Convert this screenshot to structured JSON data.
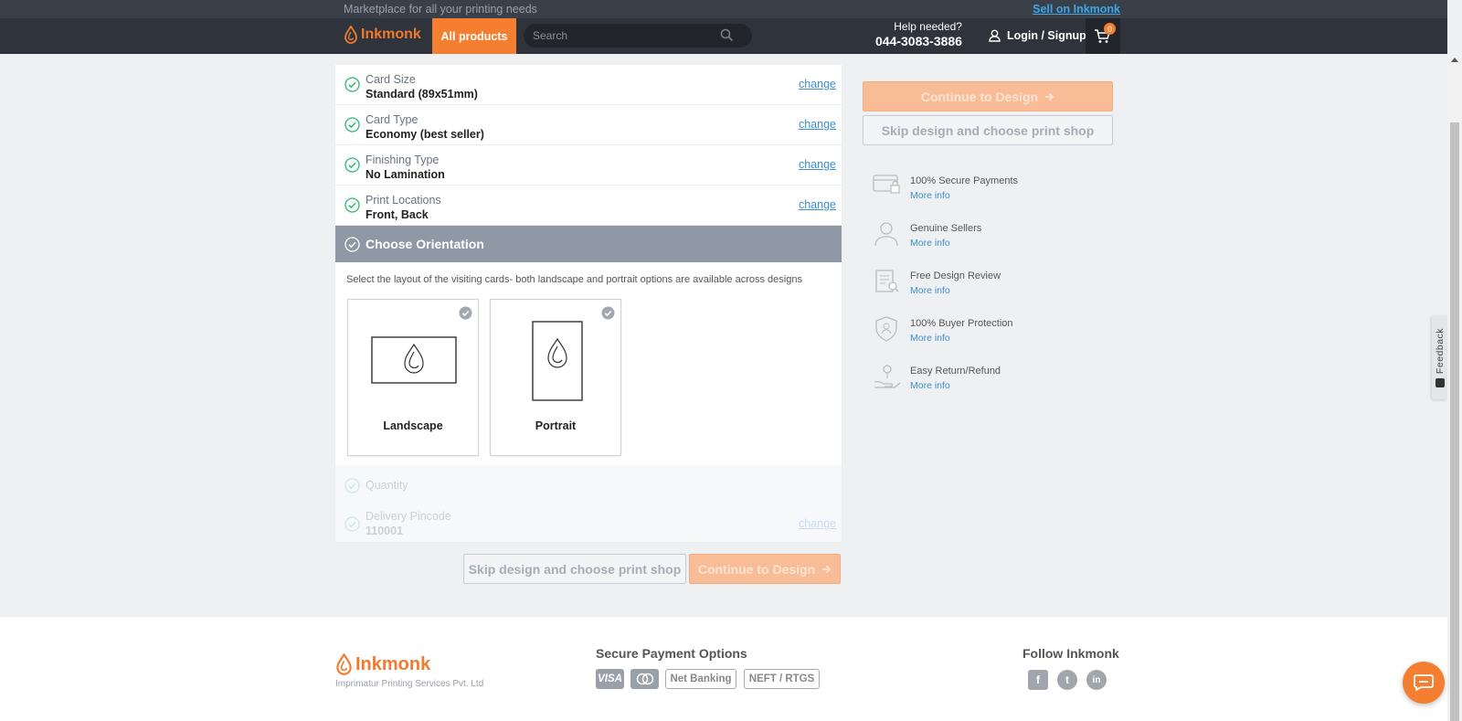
{
  "topbar": {
    "tagline": "Marketplace for all your printing needs",
    "sell_link": "Sell on Inkmonk"
  },
  "header": {
    "logo_text": "Inkmonk",
    "all_products": "All products",
    "search_placeholder": "Search",
    "help_question": "Help needed?",
    "help_phone": "044-3083-3886",
    "login_label": "Login / Signup",
    "cart_count": "0"
  },
  "config": {
    "rows": [
      {
        "label": "Card Size",
        "value": "Standard (89x51mm)",
        "action": "change"
      },
      {
        "label": "Card Type",
        "value": "Economy (best seller)",
        "action": "change"
      },
      {
        "label": "Finishing Type",
        "value": "No Lamination",
        "action": "change"
      },
      {
        "label": "Print Locations",
        "value": "Front, Back",
        "action": "change"
      }
    ],
    "orientation": {
      "title": "Choose Orientation",
      "description": "Select the layout of the visiting cards- both landscape and portrait options are available across designs",
      "options": [
        {
          "label": "Landscape"
        },
        {
          "label": "Portrait"
        }
      ]
    },
    "quantity_label": "Quantity",
    "pincode": {
      "label": "Delivery Pincode",
      "value": "110001",
      "action": "change"
    }
  },
  "actions": {
    "skip": "Skip design and choose print shop",
    "continue": "Continue to Design"
  },
  "features": [
    {
      "title": "100% Secure Payments",
      "link": "More info",
      "icon": "card-lock-icon"
    },
    {
      "title": "Genuine Sellers",
      "link": "More info",
      "icon": "person-icon"
    },
    {
      "title": "Free Design Review",
      "link": "More info",
      "icon": "document-review-icon"
    },
    {
      "title": "100% Buyer Protection",
      "link": "More info",
      "icon": "shield-icon"
    },
    {
      "title": "Easy Return/Refund",
      "link": "More info",
      "icon": "hand-refund-icon"
    }
  ],
  "feedback_label": "Feedback",
  "footer": {
    "logo_text": "Inkmonk",
    "company": "Imprimatur Printing Services Pvt. Ltd",
    "payment_title": "Secure Payment Options",
    "payments": [
      "VISA",
      "Net Banking",
      "NEFT / RTGS"
    ],
    "follow_title": "Follow Inkmonk",
    "social": [
      "f",
      "t",
      "in"
    ]
  },
  "colors": {
    "accent": "#f57f31",
    "header": "#2f343c",
    "link": "#3b8fd6"
  }
}
